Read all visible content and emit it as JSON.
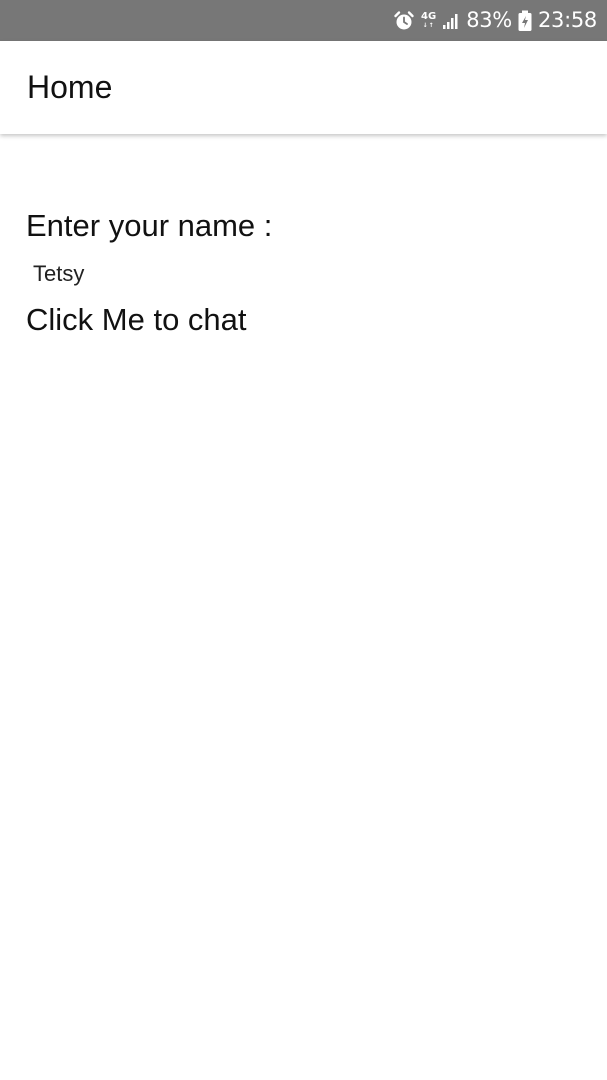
{
  "status_bar": {
    "icons": [
      "alarm-icon",
      "4g-icon",
      "signal-icon",
      "battery-charging-icon"
    ],
    "network": "4G",
    "battery": "83%",
    "time": "23:58"
  },
  "app_bar": {
    "title": "Home"
  },
  "form": {
    "name_label": "Enter your name :",
    "name_value": "Tetsy",
    "chat_link": "Click Me to chat"
  },
  "colors": {
    "status_bar": "#777777",
    "background": "#ffffff",
    "text": "#111111"
  }
}
